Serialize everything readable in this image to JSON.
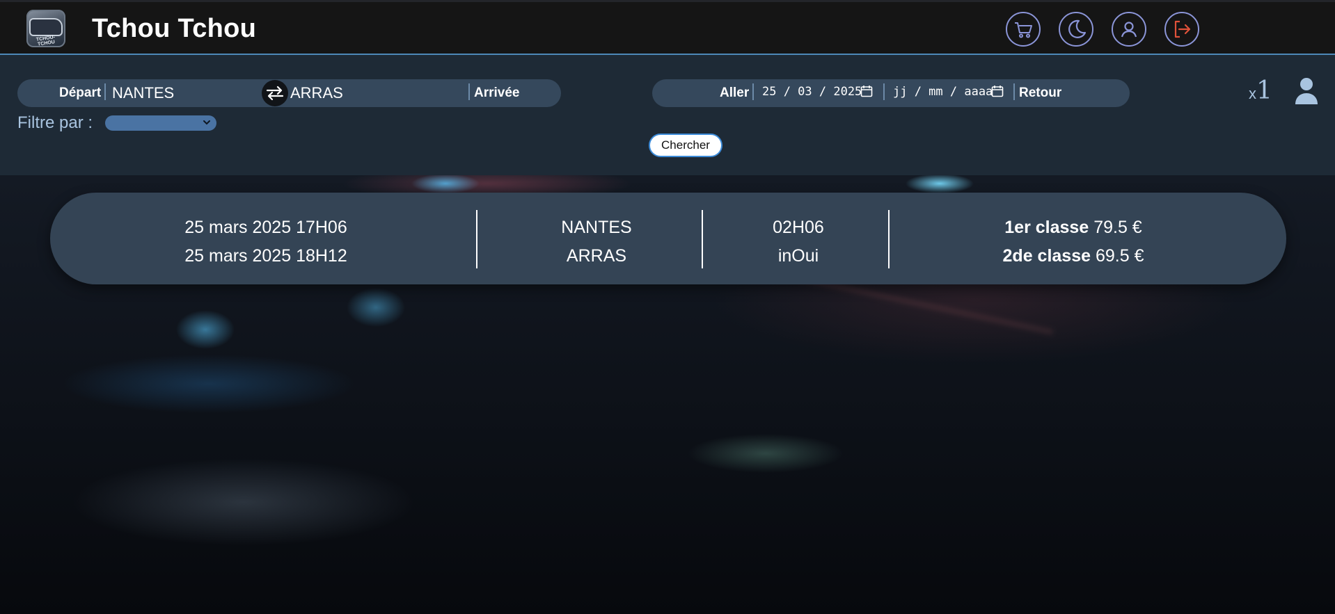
{
  "header": {
    "logo_text": "TCHOU-TCHOU",
    "title": "Tchou Tchou",
    "icons": [
      "cart-icon",
      "moon-icon",
      "user-icon",
      "logout-icon"
    ]
  },
  "search": {
    "depart_label": "Départ",
    "depart_value": "NANTES",
    "arrival_label": "Arrivée",
    "arrival_value": "ARRAS",
    "aller_label": "Aller",
    "aller_date": "25 / 03 / 2025",
    "retour_label": "Retour",
    "retour_placeholder": "jj / mm / aaaa",
    "passenger_prefix": "x",
    "passenger_count": "1",
    "filter_label": "Filtre par :",
    "filter_selected": "",
    "search_button": "Chercher"
  },
  "result": {
    "departure_datetime": "25 mars 2025 17H06",
    "arrival_datetime": "25 mars 2025 18H12",
    "origin": "NANTES",
    "destination": "ARRAS",
    "duration": "02H06",
    "train_type": "inOui",
    "first_class_label": "1er classe",
    "first_class_price": "79.5 €",
    "second_class_label": "2de classe",
    "second_class_price": "69.5 €"
  },
  "colors": {
    "header_bg": "#151515",
    "header_border": "#4d88b8",
    "search_bg": "#1e2a36",
    "pill_bg": "#35485c",
    "card_bg": "#344455",
    "icon_ring": "#8b95d8",
    "logout_accent": "#e0523a",
    "filter_select": "#4a73a3"
  }
}
